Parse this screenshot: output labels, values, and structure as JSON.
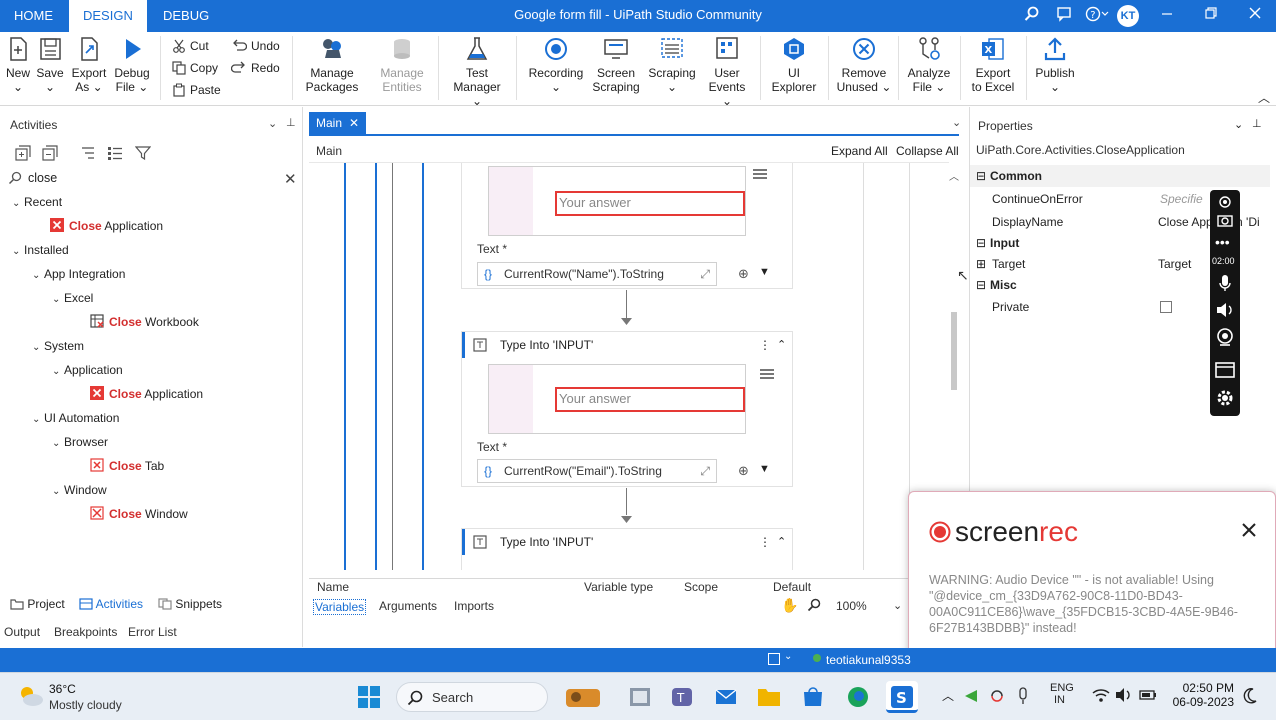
{
  "titlebar": {
    "tabs": [
      "HOME",
      "DESIGN",
      "DEBUG"
    ],
    "title": "Google form fill - UiPath Studio Community",
    "avatar": "KT"
  },
  "ribbon": {
    "new": "New",
    "save": "Save",
    "export_as": [
      "Export",
      "As"
    ],
    "debug_file": [
      "Debug",
      "File"
    ],
    "cut": "Cut",
    "copy": "Copy",
    "paste": "Paste",
    "undo": "Undo",
    "redo": "Redo",
    "manage_packages": [
      "Manage",
      "Packages"
    ],
    "manage_entities": [
      "Manage",
      "Entities"
    ],
    "test_manager": [
      "Test",
      "Manager"
    ],
    "recording": "Recording",
    "screen_scraping": [
      "Screen",
      "Scraping"
    ],
    "scraping": "Scraping",
    "user_events": [
      "User",
      "Events"
    ],
    "ui_explorer": [
      "UI",
      "Explorer"
    ],
    "remove_unused": [
      "Remove",
      "Unused"
    ],
    "analyze_file": [
      "Analyze",
      "File"
    ],
    "export_excel": [
      "Export",
      "to Excel"
    ],
    "publish": "Publish"
  },
  "activities": {
    "header": "Activities",
    "search_value": "close",
    "highlight": "Close",
    "recent_label": "Recent",
    "recent_item": "Application",
    "installed_label": "Installed",
    "app_integration": "App Integration",
    "excel": "Excel",
    "workbook": "Workbook",
    "system": "System",
    "application": "Application",
    "application_item": "Application",
    "ui_automation": "UI Automation",
    "browser": "Browser",
    "tab_item": "Tab",
    "window": "Window",
    "window_item": "Window"
  },
  "bottom_tabs": {
    "project": "Project",
    "activities": "Activities",
    "snippets": "Snippets",
    "output": "Output",
    "breakpoints": "Breakpoints",
    "error_list": "Error List"
  },
  "designer": {
    "tab": "Main",
    "breadcrumb": "Main",
    "expand_all": "Expand All",
    "collapse_all": "Collapse All",
    "answer_placeholder": "Your answer",
    "text_label": "Text *",
    "expr1": "CurrentRow(\"Name\").ToString",
    "expr2": "CurrentRow(\"Email\").ToString",
    "type_into": "Type Into 'INPUT'",
    "vars_cols": [
      "Name",
      "Variable type",
      "Scope",
      "Default"
    ],
    "vars_tabs": [
      "Variables",
      "Arguments",
      "Imports"
    ],
    "zoom": "100%"
  },
  "properties": {
    "header": "Properties",
    "activity": "UiPath.Core.Activities.CloseApplication",
    "common": "Common",
    "continue_on_error": "ContinueOnError",
    "continue_value": "Specifie",
    "display_name": "DisplayName",
    "display_value": "Close App     on 'Di",
    "input": "Input",
    "target": "Target",
    "target_value": "Target",
    "misc": "Misc",
    "private": "Private"
  },
  "status": {
    "user": "teotiakunal9353"
  },
  "recorder": {
    "time": "02:00"
  },
  "popup": {
    "brand_a": "screen",
    "brand_b": "rec",
    "warning": "WARNING: Audio Device \"\" - is not avaliable! Using \"@device_cm_{33D9A762-90C8-11D0-BD43-00A0C911CE86}\\wave_{35FDCB15-3CBD-4A5E-9B46-6F27B143BDBB}\" instead!"
  },
  "taskbar": {
    "temp": "36°C",
    "weather": "Mostly cloudy",
    "search": "Search",
    "lang1": "ENG",
    "lang2": "IN",
    "time": "02:50 PM",
    "date": "06-09-2023"
  },
  "colors": {
    "accent": "#1a6fd4",
    "highlight": "#d32f2f",
    "answer_border": "#e53935"
  }
}
